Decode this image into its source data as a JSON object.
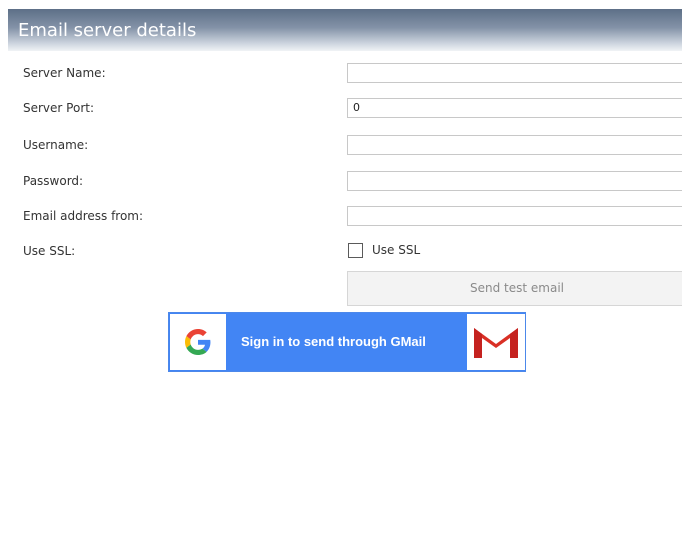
{
  "header": {
    "title": "Email server details"
  },
  "form": {
    "server_name": {
      "label": "Server Name:",
      "value": ""
    },
    "server_port": {
      "label": "Server Port:",
      "value": "0"
    },
    "username": {
      "label": "Username:",
      "value": ""
    },
    "password": {
      "label": "Password:",
      "value": ""
    },
    "email_from": {
      "label": "Email address from:",
      "value": ""
    },
    "use_ssl": {
      "label": "Use SSL:",
      "checkbox_label": "Use SSL",
      "checked": false
    }
  },
  "buttons": {
    "send_test": "Send test email",
    "gmail_signin": "Sign in to send through GMail"
  },
  "colors": {
    "gmail_blue": "#4285f4",
    "gmail_red": "#d93025"
  },
  "icons": {
    "google": "google-g-icon",
    "gmail": "gmail-m-icon"
  }
}
